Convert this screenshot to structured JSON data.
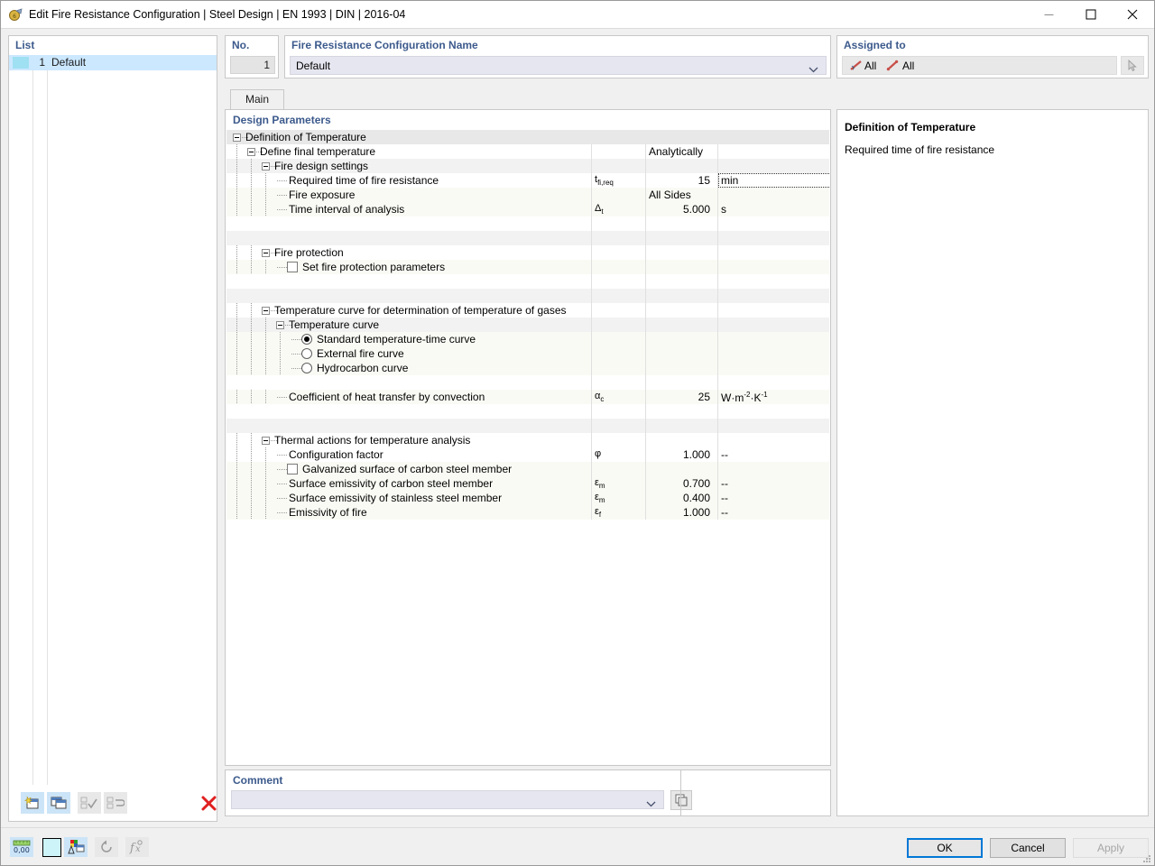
{
  "window": {
    "title": "Edit Fire Resistance Configuration | Steel Design | EN 1993 | DIN | 2016-04",
    "icon": "app-icon",
    "minimize": "—",
    "maximize": "□",
    "close": "✕"
  },
  "list": {
    "header": "List",
    "rows": [
      {
        "no": "1",
        "name": "Default",
        "color": "#9fe0f2"
      }
    ],
    "toolbar": [
      {
        "name": "new-item-button",
        "enabled": true
      },
      {
        "name": "copy-item-button",
        "enabled": true
      },
      {
        "name": "select-all-button",
        "enabled": false
      },
      {
        "name": "deselect-button",
        "enabled": false
      },
      {
        "name": "delete-item-button",
        "enabled": true,
        "glyph": "✕"
      }
    ]
  },
  "number": {
    "label": "No.",
    "value": "1"
  },
  "name": {
    "label": "Fire Resistance Configuration Name",
    "value": "Default"
  },
  "assigned": {
    "label": "Assigned to",
    "items": [
      {
        "icon": "member-icon",
        "text": "All"
      },
      {
        "icon": "node-icon",
        "text": "All"
      }
    ],
    "pick_button": "select-objects-button"
  },
  "tabs": [
    {
      "label": "Main",
      "active": true
    }
  ],
  "tree": {
    "title": "Design Parameters",
    "rows": [
      {
        "id": "definition-of-temperature",
        "label": "Definition of Temperature",
        "indent": 0,
        "kind": "group",
        "expander": true,
        "bg": "group"
      },
      {
        "id": "define-final-temperature",
        "label": "Define final temperature",
        "indent": 1,
        "kind": "group",
        "expander": true,
        "bg": "white",
        "wide": "Analytically"
      },
      {
        "id": "fire-design-settings",
        "label": "Fire design settings",
        "indent": 2,
        "kind": "group",
        "expander": true,
        "bg": "pale"
      },
      {
        "id": "required-time-of-fire-resistance",
        "label": "Required time of fire resistance",
        "indent": 3,
        "kind": "value",
        "bg": "white",
        "symbol": "t fi,req",
        "value": "15",
        "unit": "min",
        "focused": true
      },
      {
        "id": "fire-exposure",
        "label": "Fire exposure",
        "indent": 3,
        "kind": "value",
        "bg": "data",
        "wide": "All Sides"
      },
      {
        "id": "time-interval-of-analysis",
        "label": "Time interval of analysis",
        "indent": 3,
        "kind": "value",
        "bg": "data",
        "symbol": "Δt",
        "value": "5.000",
        "unit": "s"
      },
      {
        "id": "spacer-1",
        "label": "",
        "indent": 0,
        "kind": "spacer",
        "bg": "white"
      },
      {
        "id": "spacer-2",
        "label": "",
        "indent": 0,
        "kind": "spacer",
        "bg": "pale"
      },
      {
        "id": "fire-protection",
        "label": "Fire protection",
        "indent": 2,
        "kind": "group",
        "expander": true,
        "bg": "white"
      },
      {
        "id": "set-fire-protection-parameters",
        "label": "Set fire protection parameters",
        "indent": 3,
        "kind": "checkbox",
        "checked": false,
        "bg": "data"
      },
      {
        "id": "spacer-3",
        "label": "",
        "indent": 0,
        "kind": "spacer",
        "bg": "white"
      },
      {
        "id": "spacer-4",
        "label": "",
        "indent": 0,
        "kind": "spacer",
        "bg": "pale"
      },
      {
        "id": "temperature-curve-for-gases",
        "label": "Temperature curve for determination of temperature of gases",
        "indent": 2,
        "kind": "group",
        "expander": true,
        "bg": "white"
      },
      {
        "id": "temperature-curve",
        "label": "Temperature curve",
        "indent": 3,
        "kind": "group",
        "expander": true,
        "bg": "pale"
      },
      {
        "id": "standard-temperature-time-curve",
        "label": "Standard temperature-time curve",
        "indent": 4,
        "kind": "radio",
        "checked": true,
        "bg": "data"
      },
      {
        "id": "external-fire-curve",
        "label": "External fire curve",
        "indent": 4,
        "kind": "radio",
        "checked": false,
        "bg": "data"
      },
      {
        "id": "hydrocarbon-curve",
        "label": "Hydrocarbon curve",
        "indent": 4,
        "kind": "radio",
        "checked": false,
        "bg": "data"
      },
      {
        "id": "spacer-5",
        "label": "",
        "indent": 0,
        "kind": "spacer",
        "bg": "white"
      },
      {
        "id": "coefficient-of-heat-transfer-by-convection",
        "label": "Coefficient of heat transfer by convection",
        "indent": 3,
        "kind": "value",
        "bg": "data",
        "symbol": "αc",
        "value": "25",
        "unit": "W·m-2·K-1"
      },
      {
        "id": "spacer-6",
        "label": "",
        "indent": 0,
        "kind": "spacer",
        "bg": "white"
      },
      {
        "id": "spacer-7",
        "label": "",
        "indent": 0,
        "kind": "spacer",
        "bg": "pale"
      },
      {
        "id": "thermal-actions-for-temperature-analysis",
        "label": "Thermal actions for temperature analysis",
        "indent": 2,
        "kind": "group",
        "expander": true,
        "bg": "white"
      },
      {
        "id": "configuration-factor",
        "label": "Configuration factor",
        "indent": 3,
        "kind": "value",
        "bg": "white",
        "symbol": "φ",
        "value": "1.000",
        "unit": "--"
      },
      {
        "id": "galvanized-surface-of-carbon-steel-member",
        "label": "Galvanized surface of carbon steel member",
        "indent": 3,
        "kind": "checkbox",
        "checked": false,
        "bg": "data"
      },
      {
        "id": "surface-emissivity-of-carbon-steel-member",
        "label": "Surface emissivity of carbon steel member",
        "indent": 3,
        "kind": "value",
        "bg": "data",
        "symbol": "εm",
        "value": "0.700",
        "unit": "--"
      },
      {
        "id": "surface-emissivity-of-stainless-steel-member",
        "label": "Surface emissivity of stainless steel member",
        "indent": 3,
        "kind": "value",
        "bg": "data",
        "symbol": "εm",
        "value": "0.400",
        "unit": "--"
      },
      {
        "id": "emissivity-of-fire",
        "label": "Emissivity of fire",
        "indent": 3,
        "kind": "value",
        "bg": "data",
        "symbol": "εf",
        "value": "1.000",
        "unit": "--"
      }
    ]
  },
  "comment": {
    "label": "Comment",
    "value": "",
    "button": "comment-library-button"
  },
  "info": {
    "title": "Definition of Temperature",
    "text": "Required time of fire resistance"
  },
  "statusbar": [
    {
      "name": "units-button",
      "enabled": true
    },
    {
      "name": "color-swatch-button",
      "enabled": true
    },
    {
      "name": "display-properties-button",
      "enabled": true
    },
    {
      "name": "reset-button",
      "enabled": false
    },
    {
      "name": "formula-button",
      "enabled": false
    }
  ],
  "footer": {
    "ok": "OK",
    "cancel": "Cancel",
    "apply": "Apply"
  },
  "colors": {
    "accent": "#0078d7",
    "header_label": "#3c5a8c",
    "selection": "#cce8ff",
    "delete_red": "#e02020"
  }
}
